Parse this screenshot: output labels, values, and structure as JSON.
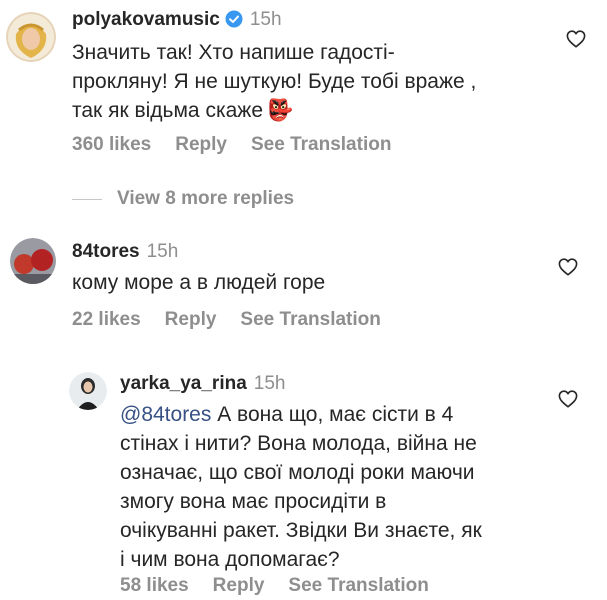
{
  "comments": [
    {
      "username": "polyakovamusic",
      "verified": true,
      "time": "15h",
      "lines": [
        "Значить так! Хто  напише гадості-",
        "прокляну! Я не шуткую! Буде тобі враже ,",
        "так як відьма скаже"
      ],
      "emoji": "👺",
      "likes": "360 likes",
      "reply": "Reply",
      "translation": "See Translation"
    },
    {
      "username": "84tores",
      "time": "15h",
      "lines": [
        "кому море а в людей  горе"
      ],
      "likes": "22 likes",
      "reply": "Reply",
      "translation": "See Translation"
    },
    {
      "username": "yarka_ya_rina",
      "time": "15h",
      "mention": "@84tores",
      "lines": [
        " А вона що, має сісти в 4",
        "стінах і нити? Вона молода, війна не",
        "означає, що свої молоді роки маючи",
        "змогу вона має просидіти в",
        "очікуванні ракет. Звідки Ви знаєте, як",
        "і чим вона допомагає?"
      ],
      "likes": "58 likes",
      "reply": "Reply",
      "translation": "See Translation"
    }
  ],
  "view_replies": "View 8 more replies",
  "colors": {
    "text": "#262626",
    "secondary": "#8e8e8e",
    "mention": "#385185",
    "verified": "#3897f0"
  },
  "icons": {
    "heart": "heart-outline-icon",
    "verified": "verified-badge-icon"
  }
}
